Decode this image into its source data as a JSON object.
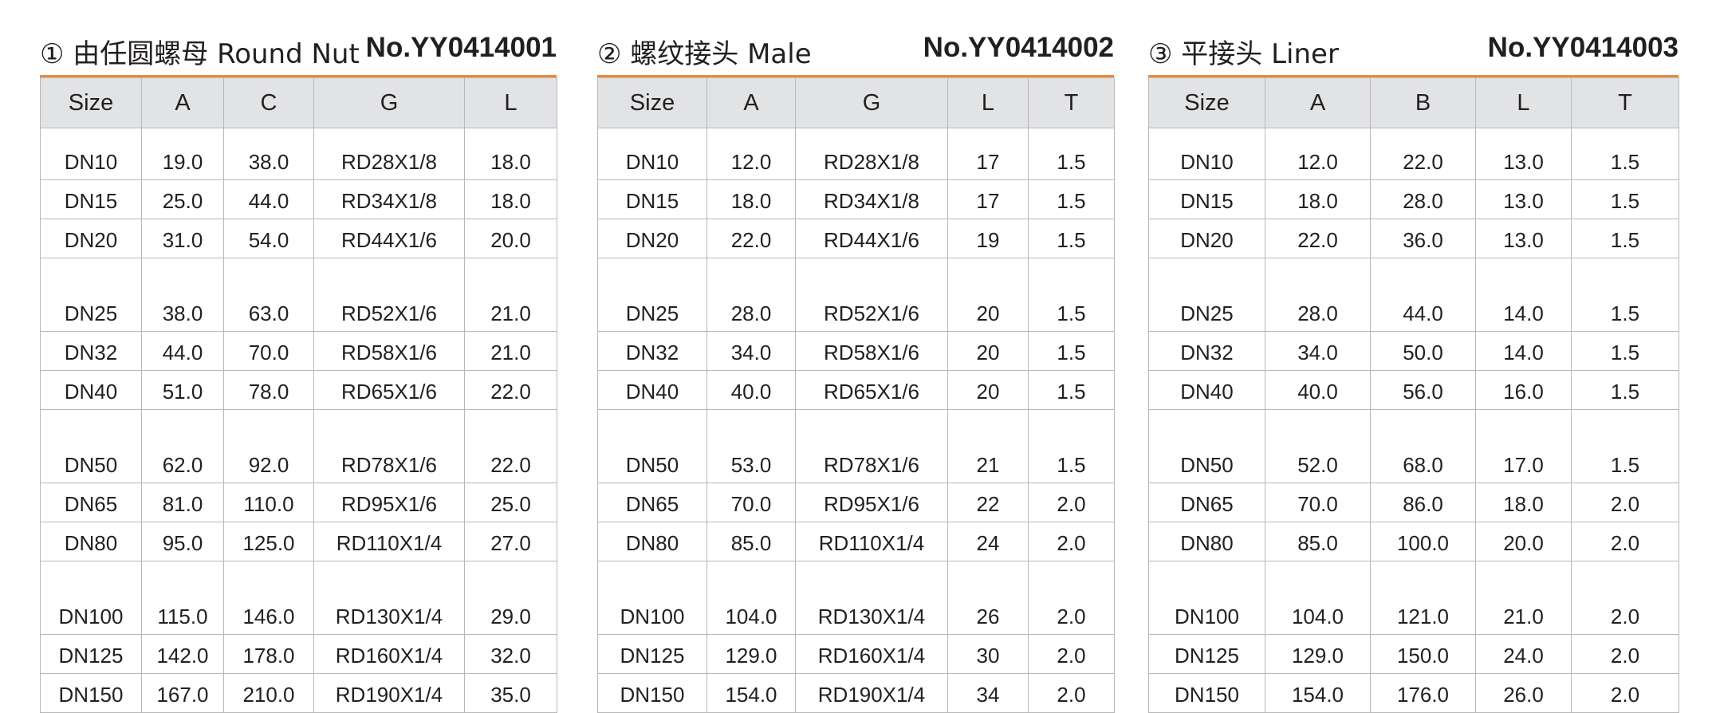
{
  "panels": [
    {
      "title": "① 由任圆螺母 Round Nut",
      "code": "No.YY0414001",
      "columns": [
        "Size",
        "A",
        "C",
        "G",
        "L"
      ],
      "rows": [
        [
          "DN10",
          "19.0",
          "38.0",
          "RD28X1/8",
          "18.0"
        ],
        [
          "DN15",
          "25.0",
          "44.0",
          "RD34X1/8",
          "18.0"
        ],
        [
          "DN20",
          "31.0",
          "54.0",
          "RD44X1/6",
          "20.0"
        ],
        [
          "DN25",
          "38.0",
          "63.0",
          "RD52X1/6",
          "21.0"
        ],
        [
          "DN32",
          "44.0",
          "70.0",
          "RD58X1/6",
          "21.0"
        ],
        [
          "DN40",
          "51.0",
          "78.0",
          "RD65X1/6",
          "22.0"
        ],
        [
          "DN50",
          "62.0",
          "92.0",
          "RD78X1/6",
          "22.0"
        ],
        [
          "DN65",
          "81.0",
          "110.0",
          "RD95X1/6",
          "25.0"
        ],
        [
          "DN80",
          "95.0",
          "125.0",
          "RD110X1/4",
          "27.0"
        ],
        [
          "DN100",
          "115.0",
          "146.0",
          "RD130X1/4",
          "29.0"
        ],
        [
          "DN125",
          "142.0",
          "178.0",
          "RD160X1/4",
          "32.0"
        ],
        [
          "DN150",
          "167.0",
          "210.0",
          "RD190X1/4",
          "35.0"
        ]
      ]
    },
    {
      "title": "② 螺纹接头  Male",
      "code": "No.YY0414002",
      "columns": [
        "Size",
        "A",
        "G",
        "L",
        "T"
      ],
      "rows": [
        [
          "DN10",
          "12.0",
          "RD28X1/8",
          "17",
          "1.5"
        ],
        [
          "DN15",
          "18.0",
          "RD34X1/8",
          "17",
          "1.5"
        ],
        [
          "DN20",
          "22.0",
          "RD44X1/6",
          "19",
          "1.5"
        ],
        [
          "DN25",
          "28.0",
          "RD52X1/6",
          "20",
          "1.5"
        ],
        [
          "DN32",
          "34.0",
          "RD58X1/6",
          "20",
          "1.5"
        ],
        [
          "DN40",
          "40.0",
          "RD65X1/6",
          "20",
          "1.5"
        ],
        [
          "DN50",
          "53.0",
          "RD78X1/6",
          "21",
          "1.5"
        ],
        [
          "DN65",
          "70.0",
          "RD95X1/6",
          "22",
          "2.0"
        ],
        [
          "DN80",
          "85.0",
          "RD110X1/4",
          "24",
          "2.0"
        ],
        [
          "DN100",
          "104.0",
          "RD130X1/4",
          "26",
          "2.0"
        ],
        [
          "DN125",
          "129.0",
          "RD160X1/4",
          "30",
          "2.0"
        ],
        [
          "DN150",
          "154.0",
          "RD190X1/4",
          "34",
          "2.0"
        ]
      ]
    },
    {
      "title": "③ 平接头 Liner",
      "code": "No.YY0414003",
      "columns": [
        "Size",
        "A",
        "B",
        "L",
        "T"
      ],
      "rows": [
        [
          "DN10",
          "12.0",
          "22.0",
          "13.0",
          "1.5"
        ],
        [
          "DN15",
          "18.0",
          "28.0",
          "13.0",
          "1.5"
        ],
        [
          "DN20",
          "22.0",
          "36.0",
          "13.0",
          "1.5"
        ],
        [
          "DN25",
          "28.0",
          "44.0",
          "14.0",
          "1.5"
        ],
        [
          "DN32",
          "34.0",
          "50.0",
          "14.0",
          "1.5"
        ],
        [
          "DN40",
          "40.0",
          "56.0",
          "16.0",
          "1.5"
        ],
        [
          "DN50",
          "52.0",
          "68.0",
          "17.0",
          "1.5"
        ],
        [
          "DN65",
          "70.0",
          "86.0",
          "18.0",
          "2.0"
        ],
        [
          "DN80",
          "85.0",
          "100.0",
          "20.0",
          "2.0"
        ],
        [
          "DN100",
          "104.0",
          "121.0",
          "21.0",
          "2.0"
        ],
        [
          "DN125",
          "129.0",
          "150.0",
          "24.0",
          "2.0"
        ],
        [
          "DN150",
          "154.0",
          "176.0",
          "26.0",
          "2.0"
        ]
      ]
    }
  ]
}
